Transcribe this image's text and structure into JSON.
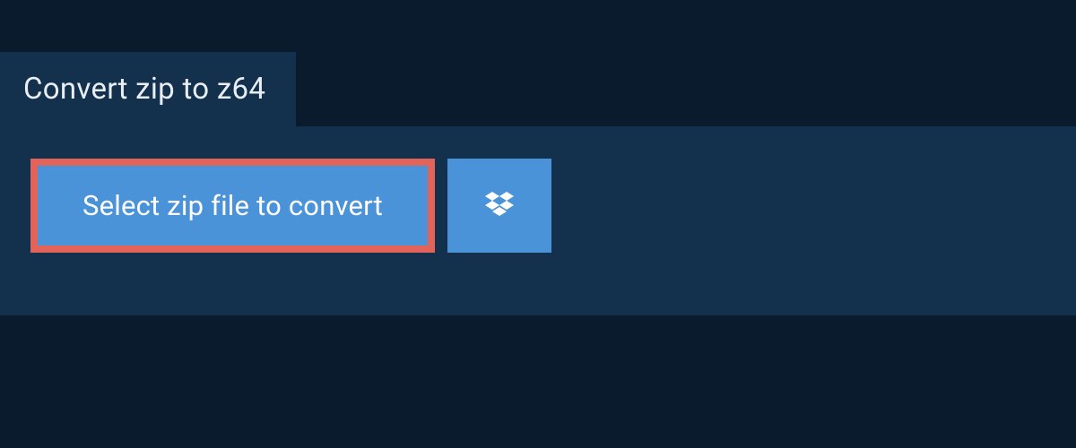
{
  "tab": {
    "label": "Convert zip to z64"
  },
  "actions": {
    "select_file_label": "Select zip file to convert"
  },
  "colors": {
    "background": "#0a1b2e",
    "panel": "#13304d",
    "button": "#4a93d9",
    "highlight_border": "#e2635a",
    "text_light": "#e8eef4",
    "text_white": "#ffffff"
  }
}
